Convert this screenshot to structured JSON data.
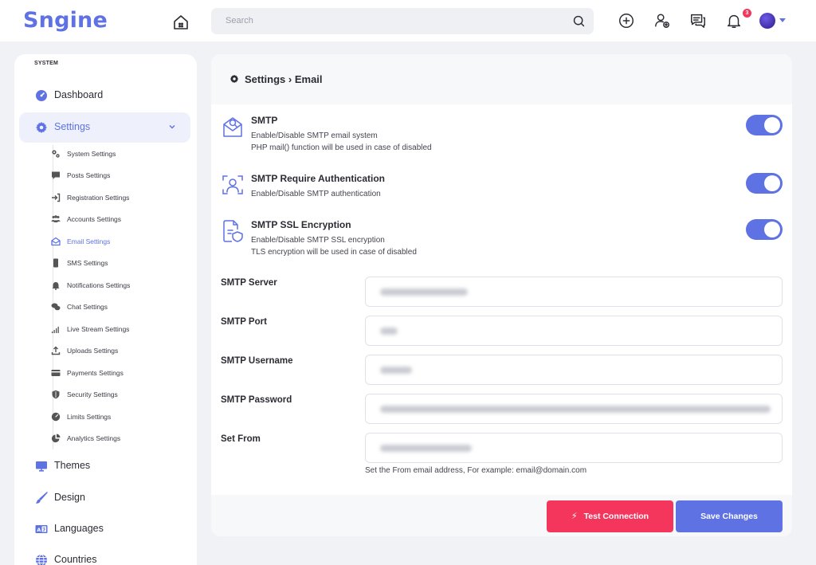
{
  "app": {
    "logo": "Sngine"
  },
  "search": {
    "placeholder": "Search"
  },
  "topbar": {
    "notifications_count": "3"
  },
  "sidebar": {
    "section_label": "SYSTEM",
    "items": [
      {
        "label": "Dashboard",
        "icon": "dashboard-icon"
      },
      {
        "label": "Settings",
        "icon": "gear-icon",
        "active": true
      },
      {
        "label": "Themes",
        "icon": "monitor-icon"
      },
      {
        "label": "Design",
        "icon": "brush-icon"
      },
      {
        "label": "Languages",
        "icon": "language-icon"
      },
      {
        "label": "Countries",
        "icon": "globe-icon"
      }
    ],
    "sub_items": [
      {
        "label": "System Settings"
      },
      {
        "label": "Posts Settings"
      },
      {
        "label": "Registration Settings"
      },
      {
        "label": "Accounts Settings"
      },
      {
        "label": "Email Settings",
        "active": true
      },
      {
        "label": "SMS Settings"
      },
      {
        "label": "Notifications Settings"
      },
      {
        "label": "Chat Settings"
      },
      {
        "label": "Live Stream Settings"
      },
      {
        "label": "Uploads Settings"
      },
      {
        "label": "Payments Settings"
      },
      {
        "label": "Security Settings"
      },
      {
        "label": "Limits Settings"
      },
      {
        "label": "Analytics Settings"
      }
    ]
  },
  "page": {
    "title": "Settings › Email",
    "toggles": [
      {
        "title": "SMTP",
        "desc1": "Enable/Disable SMTP email system",
        "desc2": "PHP mail() function will be used in case of disabled",
        "on": true
      },
      {
        "title": "SMTP Require Authentication",
        "desc1": "Enable/Disable SMTP authentication",
        "on": true
      },
      {
        "title": "SMTP SSL Encryption",
        "desc1": "Enable/Disable SMTP SSL encryption",
        "desc2": "TLS encryption will be used in case of disabled",
        "on": true
      }
    ],
    "fields": [
      {
        "label": "SMTP Server"
      },
      {
        "label": "SMTP Port"
      },
      {
        "label": "SMTP Username"
      },
      {
        "label": "SMTP Password"
      },
      {
        "label": "Set From"
      }
    ],
    "set_from_help": "Set the From email address, For example: email@domain.com",
    "buttons": {
      "test": "Test Connection",
      "save": "Save Changes"
    }
  },
  "colors": {
    "accent": "#5e72e4",
    "danger": "#f5365c",
    "background": "#f1f2f6"
  }
}
